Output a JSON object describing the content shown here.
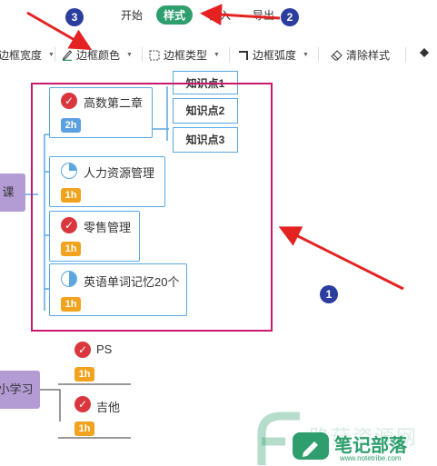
{
  "menu": {
    "items": [
      "开始",
      "样式",
      "插入",
      "导出"
    ],
    "active_index": 1,
    "accent": "#2e9e6e"
  },
  "toolbar": {
    "border_width": "边框宽度",
    "border_color": "边框颜色",
    "border_type": "边框类型",
    "border_radius": "边框弧度",
    "clear_style": "清除样式"
  },
  "annotations": {
    "num1": "1",
    "num2": "2",
    "num3": "3",
    "highlight_color": "#c8196b",
    "arrow_color": "#e52222"
  },
  "mindmap": {
    "root1": "课",
    "root2": "小学习",
    "nodes": [
      {
        "label": "高数第二章",
        "badge": "2h",
        "status": "done"
      },
      {
        "label": "人力资源管理",
        "badge": "1h",
        "status": "quarter"
      },
      {
        "label": "零售管理",
        "badge": "1h",
        "status": "done"
      },
      {
        "label": "英语单词记忆20个",
        "badge": "1h",
        "status": "half"
      }
    ],
    "knowledge": [
      "知识点1",
      "知识点2",
      "知识点3"
    ],
    "sub_nodes": [
      {
        "label": "PS",
        "badge": "1h",
        "status": "done"
      },
      {
        "label": "吉他",
        "badge": "1h",
        "status": "done"
      }
    ]
  },
  "watermark": {
    "brand": "笔记部落",
    "site": "www.notetribe.com",
    "faded": "路菇资源网"
  }
}
